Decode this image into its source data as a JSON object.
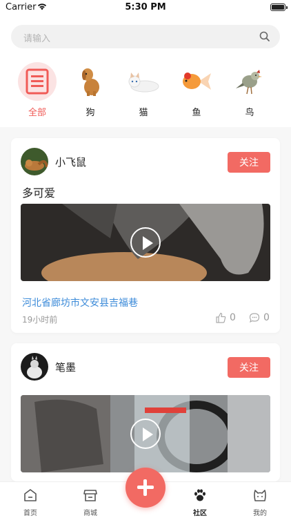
{
  "status_bar": {
    "carrier": "Carrier",
    "time": "5:30 PM"
  },
  "search": {
    "placeholder": "请输入"
  },
  "categories": [
    {
      "label": "全部",
      "icon": "list-document-icon",
      "active": true
    },
    {
      "label": "狗",
      "icon": "dog-icon"
    },
    {
      "label": "猫",
      "icon": "cat-icon"
    },
    {
      "label": "鱼",
      "icon": "fish-icon"
    },
    {
      "label": "鸟",
      "icon": "bird-icon"
    }
  ],
  "posts": [
    {
      "user_name": "小飞鼠",
      "follow_label": "关注",
      "text": "多可爱",
      "location": "河北省廊坊市文安县吉福巷",
      "time": "19小时前",
      "likes": "0",
      "comments": "0"
    },
    {
      "user_name": "笔墨",
      "follow_label": "关注"
    }
  ],
  "nav": {
    "items": [
      {
        "label": "首页",
        "icon": "home-icon"
      },
      {
        "label": "商城",
        "icon": "store-icon"
      },
      {
        "label": "社区",
        "icon": "paw-icon",
        "active": true
      },
      {
        "label": "我的",
        "icon": "cat-face-icon"
      }
    ],
    "fab_icon": "plus-icon"
  },
  "colors": {
    "accent": "#f26a63",
    "link": "#3c8bd9",
    "active_bg": "#fbe3e3"
  }
}
